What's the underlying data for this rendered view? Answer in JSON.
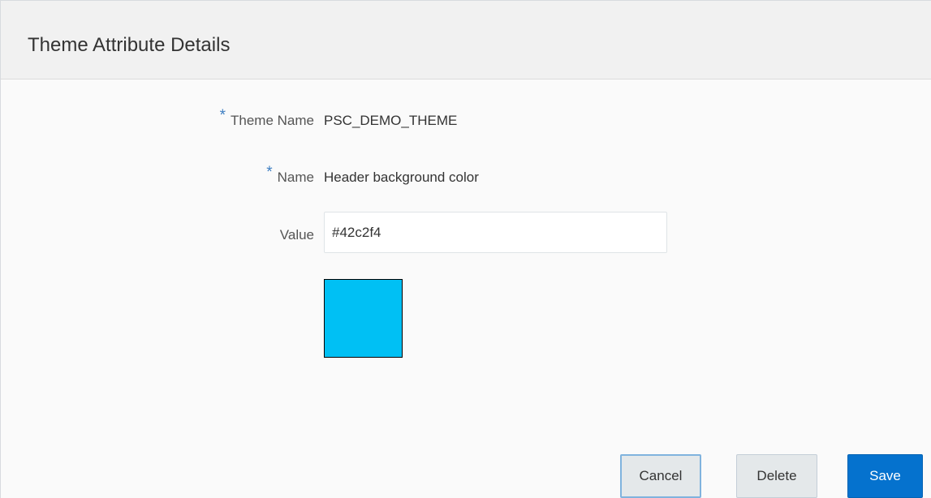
{
  "dialog": {
    "title": "Theme Attribute Details"
  },
  "form": {
    "theme_name": {
      "required_mark": "*",
      "label": "Theme Name",
      "value": "PSC_DEMO_THEME"
    },
    "name": {
      "required_mark": "*",
      "label": "Name",
      "value": "Header background color"
    },
    "value": {
      "label": "Value",
      "input_value": "#42c2f4"
    },
    "color_preview": {
      "color": "#00c0f4",
      "border_color": "#000000"
    }
  },
  "buttons": {
    "cancel_label": "Cancel",
    "delete_label": "Delete",
    "save_label": "Save"
  },
  "colors": {
    "primary_accent": "#0572ce",
    "required_mark": "#3e7ec2"
  }
}
